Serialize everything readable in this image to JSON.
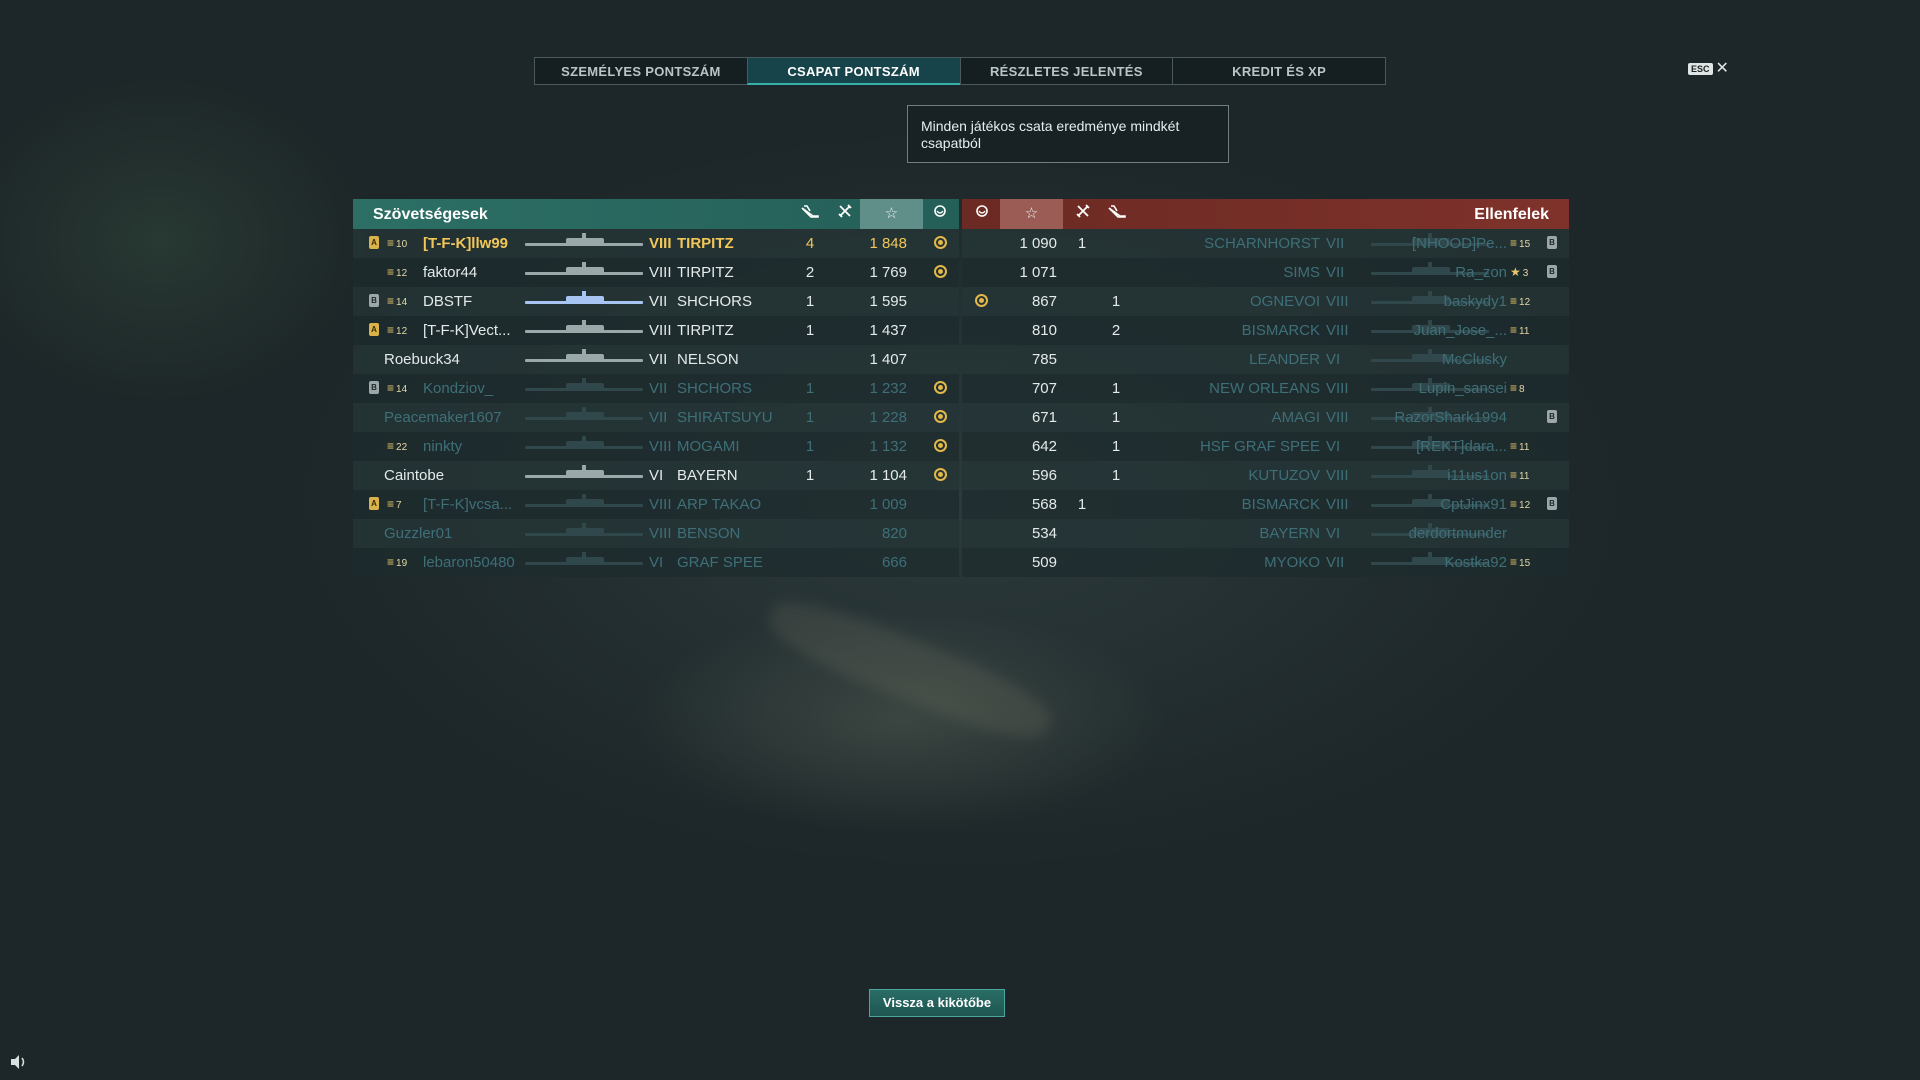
{
  "tabs": [
    "SZEMÉLYES PONTSZÁM",
    "CSAPAT PONTSZÁM",
    "RÉSZLETES JELENTÉS",
    "KREDIT ÉS XP"
  ],
  "active_tab": 1,
  "esc_label": "ESC",
  "tooltip": "Minden játékos csata eredménye mindkét csapatból",
  "allies_title": "Szövetségesek",
  "enemies_title": "Ellenfelek",
  "header_icons": {
    "planes": "plane-kills-icon",
    "kills": "ship-kills-icon",
    "score": "star-icon",
    "achievements": "achievement-icon"
  },
  "colors": {
    "allies_header": "#2c6f65",
    "enemies_header": "#7e322a",
    "highlight_player": "#f2c758",
    "alive_text": "#e4eaea",
    "dead_text": "#3e6f78",
    "alive_ship": "#9aa8aa",
    "dead_ship": "#30484c",
    "self_ship": "#a8c4f2"
  },
  "allies": [
    {
      "badge": "gold",
      "rank": "10",
      "name": "[T-F-K]llw99",
      "tier": "VIII",
      "ship": "TIRPITZ",
      "kills": "4",
      "score": "1 848",
      "ach": true,
      "dead": false,
      "self": true
    },
    {
      "badge": "",
      "rank": "12",
      "name": "faktor44",
      "tier": "VIII",
      "ship": "TIRPITZ",
      "kills": "2",
      "score": "1 769",
      "ach": true,
      "dead": false
    },
    {
      "badge": "grey",
      "rank": "14",
      "name": "DBSTF",
      "tier": "VII",
      "ship": "SHCHORS",
      "kills": "1",
      "score": "1 595",
      "ach": false,
      "dead": false,
      "blue": true
    },
    {
      "badge": "gold",
      "rank": "12",
      "name": "[T-F-K]Vect...",
      "tier": "VIII",
      "ship": "TIRPITZ",
      "kills": "1",
      "score": "1 437",
      "ach": false,
      "dead": false
    },
    {
      "badge": "",
      "rank": "",
      "name": "Roebuck34",
      "tier": "VII",
      "ship": "NELSON",
      "kills": "",
      "score": "1 407",
      "ach": false,
      "dead": false
    },
    {
      "badge": "grey",
      "rank": "14",
      "name": "Kondziov_",
      "tier": "VII",
      "ship": "SHCHORS",
      "kills": "1",
      "score": "1 232",
      "ach": true,
      "dead": true
    },
    {
      "badge": "",
      "rank": "",
      "name": "Peacemaker1607",
      "tier": "VII",
      "ship": "SHIRATSUYU",
      "kills": "1",
      "score": "1 228",
      "ach": true,
      "dead": true
    },
    {
      "badge": "",
      "rank": "22",
      "name": "ninkty",
      "tier": "VIII",
      "ship": "MOGAMI",
      "kills": "1",
      "score": "1 132",
      "ach": true,
      "dead": true
    },
    {
      "badge": "",
      "rank": "",
      "name": "Caintobe",
      "tier": "VI",
      "ship": "BAYERN",
      "kills": "1",
      "score": "1 104",
      "ach": true,
      "dead": false
    },
    {
      "badge": "gold",
      "rank": "7",
      "name": "[T-F-K]vcsa...",
      "tier": "VIII",
      "ship": "ARP TAKAO",
      "kills": "",
      "score": "1 009",
      "ach": false,
      "dead": true
    },
    {
      "badge": "",
      "rank": "",
      "name": "Guzzler01",
      "tier": "VIII",
      "ship": "BENSON",
      "kills": "",
      "score": "820",
      "ach": false,
      "dead": true
    },
    {
      "badge": "",
      "rank": "19",
      "name": "lebaron50480",
      "tier": "VI",
      "ship": "GRAF SPEE",
      "kills": "",
      "score": "666",
      "ach": false,
      "dead": true
    }
  ],
  "enemies": [
    {
      "ach": false,
      "score": "1 090",
      "planes": "1",
      "kills": "",
      "ship": "SCHARNHORST",
      "tier": "VII",
      "name": "[NHOOD]Pe...",
      "rank": "15",
      "badge": "grey",
      "dead": true
    },
    {
      "ach": false,
      "score": "1 071",
      "planes": "",
      "kills": "",
      "ship": "SIMS",
      "tier": "VII",
      "name": "Ra_zon",
      "rank": "3",
      "badge": "grey",
      "dead": true,
      "star": true
    },
    {
      "ach": true,
      "score": "867",
      "planes": "",
      "kills": "1",
      "ship": "OGNEVOI",
      "tier": "VIII",
      "name": "baskydy1",
      "rank": "12",
      "badge": "",
      "dead": true
    },
    {
      "ach": false,
      "score": "810",
      "planes": "",
      "kills": "2",
      "ship": "BISMARCK",
      "tier": "VIII",
      "name": "Juan_Jose_...",
      "rank": "11",
      "badge": "",
      "dead": true
    },
    {
      "ach": false,
      "score": "785",
      "planes": "",
      "kills": "",
      "ship": "LEANDER",
      "tier": "VI",
      "name": "McClusky",
      "rank": "",
      "badge": "",
      "dead": true
    },
    {
      "ach": false,
      "score": "707",
      "planes": "",
      "kills": "1",
      "ship": "NEW ORLEANS",
      "tier": "VIII",
      "name": "Lupin_sansei",
      "rank": "8",
      "badge": "",
      "dead": true
    },
    {
      "ach": false,
      "score": "671",
      "planes": "",
      "kills": "1",
      "ship": "AMAGI",
      "tier": "VIII",
      "name": "RazorShark1994",
      "rank": "",
      "badge": "grey",
      "dead": true
    },
    {
      "ach": false,
      "score": "642",
      "planes": "",
      "kills": "1",
      "ship": "HSF GRAF SPEE",
      "tier": "VI",
      "name": "[REKT]dara...",
      "rank": "11",
      "badge": "",
      "dead": true
    },
    {
      "ach": false,
      "score": "596",
      "planes": "",
      "kills": "1",
      "ship": "KUTUZOV",
      "tier": "VIII",
      "name": "i11us1on",
      "rank": "11",
      "badge": "",
      "dead": true
    },
    {
      "ach": false,
      "score": "568",
      "planes": "1",
      "kills": "",
      "ship": "BISMARCK",
      "tier": "VIII",
      "name": "CptJinx91",
      "rank": "12",
      "badge": "grey",
      "dead": true
    },
    {
      "ach": false,
      "score": "534",
      "planes": "",
      "kills": "",
      "ship": "BAYERN",
      "tier": "VI",
      "name": "derdortmunder",
      "rank": "",
      "badge": "",
      "dead": true
    },
    {
      "ach": false,
      "score": "509",
      "planes": "",
      "kills": "",
      "ship": "MYOKO",
      "tier": "VII",
      "name": "Kostka92",
      "rank": "15",
      "badge": "",
      "dead": true
    }
  ],
  "back_button": "Vissza a kikötőbe",
  "volume_icon": "speaker-icon"
}
